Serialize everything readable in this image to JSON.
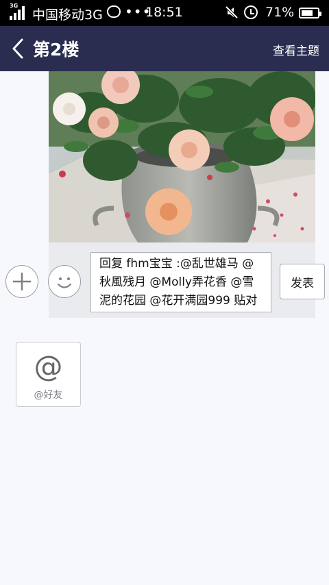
{
  "status_bar": {
    "network_tag": "3G",
    "carrier": "中国移动3G",
    "more": "•••",
    "time": "18:51",
    "battery_percent": "71%",
    "battery_level": 0.71
  },
  "header": {
    "title": "第2楼",
    "action": "查看主题"
  },
  "reply": {
    "text": "回复 fhm宝宝 :@乱世雄马 @秋風残月 @Molly弄花香 @雪泥的花园 @花开满园999 贴对你选品种有帮助",
    "send_label": "发表"
  },
  "friend_tile": {
    "symbol": "@",
    "label": "@好友"
  },
  "icons": {
    "back": "chevron-left-icon",
    "plus": "plus-icon",
    "emoji": "smiley-icon",
    "mute": "mute-icon",
    "alarm": "alarm-icon",
    "battery": "battery-icon",
    "signal": "signal-icon",
    "chat": "chat-bubble-icon"
  },
  "colors": {
    "header_bg": "#2b2d50",
    "page_bg": "#f7f8fc"
  }
}
